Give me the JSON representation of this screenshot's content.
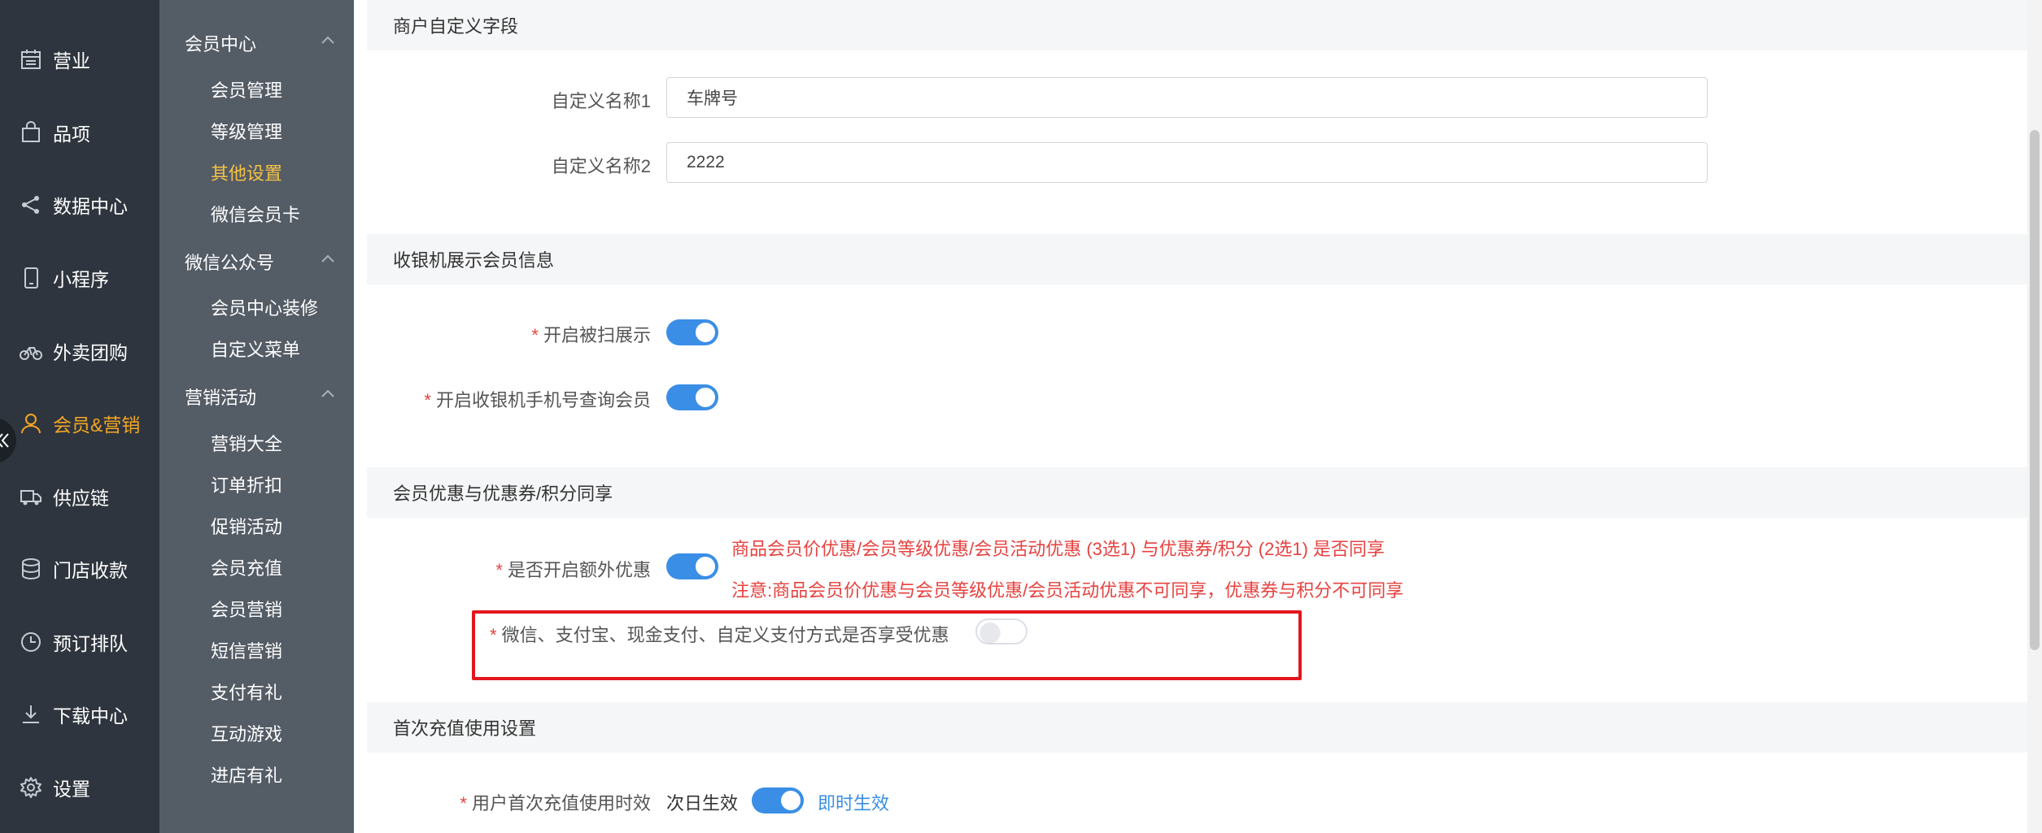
{
  "nav": {
    "items": [
      {
        "label": "营业",
        "icon": "calendar-icon"
      },
      {
        "label": "品项",
        "icon": "bag-icon"
      },
      {
        "label": "数据中心",
        "icon": "share-icon"
      },
      {
        "label": "小程序",
        "icon": "phone-icon"
      },
      {
        "label": "外卖团购",
        "icon": "bike-icon"
      },
      {
        "label": "会员&营销",
        "icon": "user-icon"
      },
      {
        "label": "供应链",
        "icon": "truck-icon"
      },
      {
        "label": "门店收款",
        "icon": "database-icon"
      },
      {
        "label": "预订排队",
        "icon": "clock-icon"
      },
      {
        "label": "下载中心",
        "icon": "download-icon"
      },
      {
        "label": "设置",
        "icon": "gear-icon"
      }
    ],
    "active_color": "#f5a623"
  },
  "submenu": {
    "groups": [
      {
        "label": "会员中心",
        "items": [
          "会员管理",
          "等级管理",
          "其他设置",
          "微信会员卡"
        ]
      },
      {
        "label": "微信公众号",
        "items": [
          "会员中心装修",
          "自定义菜单"
        ]
      },
      {
        "label": "营销活动",
        "items": [
          "营销大全",
          "订单折扣",
          "促销活动",
          "会员充值",
          "会员营销",
          "短信营销",
          "支付有礼",
          "互动游戏",
          "进店有礼"
        ]
      }
    ],
    "active_item": "其他设置"
  },
  "sections": {
    "custom_fields": {
      "title": "商户自定义字段",
      "field1_label": "自定义名称1",
      "field1_value": "车牌号",
      "field2_label": "自定义名称2",
      "field2_value": "2222"
    },
    "cashier": {
      "title": "收银机展示会员信息",
      "scan_label": "开启被扫展示",
      "scan_on": true,
      "phone_label": "开启收银机手机号查询会员",
      "phone_on": true
    },
    "discount": {
      "title": "会员优惠与优惠券/积分同享",
      "extra_label": "是否开启额外优惠",
      "extra_on": true,
      "note1": "商品会员价优惠/会员等级优惠/会员活动优惠 (3选1) 与优惠券/积分 (2选1) 是否同享",
      "note2": "注意:商品会员价优惠与会员等级优惠/会员活动优惠不可同享，优惠券与积分不可同享",
      "pay_label": "微信、支付宝、现金支付、自定义支付方式是否享受优惠",
      "pay_on": false
    },
    "recharge": {
      "title": "首次充值使用设置",
      "label": "用户首次充值使用时效",
      "left_option": "次日生效",
      "right_option": "即时生效",
      "on": true
    }
  },
  "colors": {
    "primary": "#3a8ee6",
    "required": "#e64340",
    "highlight": "#e3161e"
  },
  "required_mark": "*"
}
